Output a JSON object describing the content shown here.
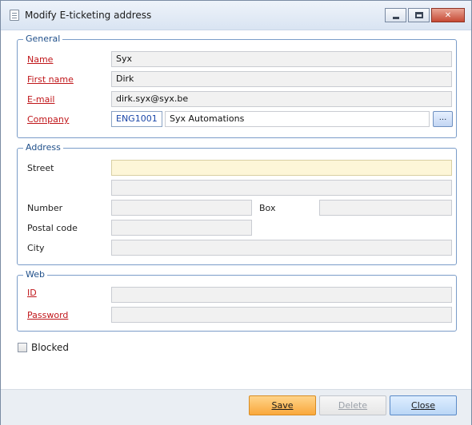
{
  "window": {
    "title": "Modify E-ticketing address",
    "minimize_icon": "minimize-icon",
    "maximize_icon": "maximize-icon",
    "close_icon": "close-icon",
    "close_glyph": "✕"
  },
  "general": {
    "legend": "General",
    "name_label": "Name",
    "name_value": "Syx",
    "firstname_label": "First name",
    "firstname_value": "Dirk",
    "email_label": "E-mail",
    "email_value": "dirk.syx@syx.be",
    "company_label": "Company",
    "company_code": "ENG1001",
    "company_name": "Syx Automations",
    "lookup_label": "..."
  },
  "address": {
    "legend": "Address",
    "street_label": "Street",
    "street_value": "",
    "street2_value": "",
    "number_label": "Number",
    "number_value": "",
    "box_label": "Box",
    "box_value": "",
    "postal_label": "Postal code",
    "postal_value": "",
    "city_label": "City",
    "city_value": ""
  },
  "web": {
    "legend": "Web",
    "id_label": "ID",
    "id_value": "",
    "password_label": "Password",
    "password_value": ""
  },
  "blocked": {
    "label": "Blocked",
    "checked": false
  },
  "footer": {
    "save_label": "Save",
    "delete_label": "Delete",
    "close_label": "Close"
  },
  "colors": {
    "required_label": "#c0161a",
    "group_border": "#7a9cc8",
    "save_button": "#f9a83c",
    "close_button": "#bad6f6",
    "focused_field": "#fdf6d8"
  }
}
